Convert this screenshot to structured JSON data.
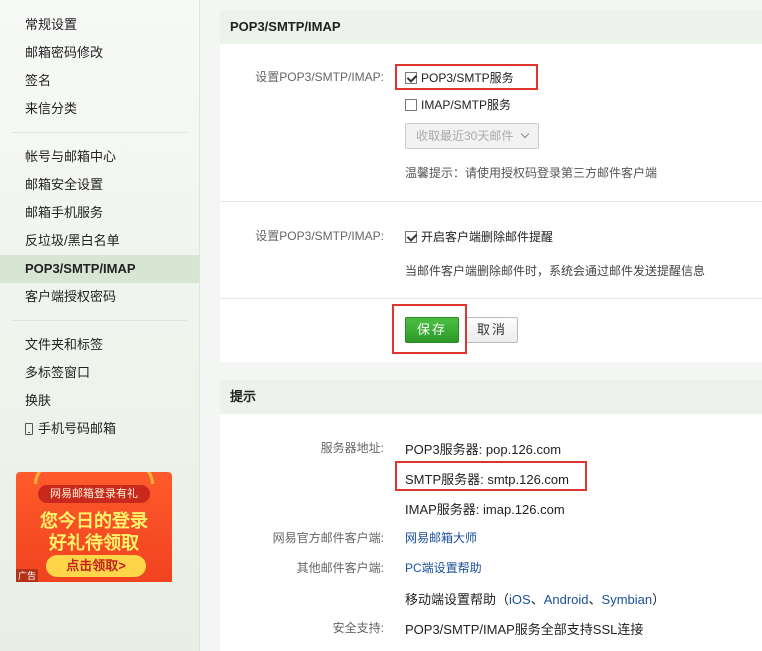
{
  "sidebar": {
    "group1": [
      "常规设置",
      "邮箱密码修改",
      "签名",
      "来信分类"
    ],
    "group2": [
      "帐号与邮箱中心",
      "邮箱安全设置",
      "邮箱手机服务",
      "反垃圾/黑白名单",
      "POP3/SMTP/IMAP",
      "客户端授权密码"
    ],
    "group3": [
      "文件夹和标签",
      "多标签窗口",
      "换肤",
      "手机号码邮箱"
    ],
    "active": "POP3/SMTP/IMAP"
  },
  "promo": {
    "top": "网易邮箱登录有礼",
    "line1": "您今日的登录",
    "line2": "好礼待领取",
    "button": "点击领取>",
    "ad": "广告"
  },
  "pop3_panel": {
    "title": "POP3/SMTP/IMAP",
    "setting_label": "设置POP3/SMTP/IMAP:",
    "pop3_option": "POP3/SMTP服务",
    "imap_option": "IMAP/SMTP服务",
    "fetch_select": "收取最近30天邮件",
    "tip": "温馨提示：请使用授权码登录第三方邮件客户端",
    "setting_label2": "设置POP3/SMTP/IMAP:",
    "delete_remind": "开启客户端删除邮件提醒",
    "delete_desc": "当邮件客户端删除邮件时，系统会通过邮件发送提醒信息",
    "save": "保存",
    "cancel": "取消"
  },
  "tips_panel": {
    "title": "提示",
    "server_label": "服务器地址:",
    "pop3_server": "POP3服务器: pop.126.com",
    "smtp_server": "SMTP服务器: smtp.126.com",
    "imap_server": "IMAP服务器: imap.126.com",
    "official_label": "网易官方邮件客户端:",
    "official_link": "网易邮箱大师",
    "other_label": "其他邮件客户端:",
    "pc_help": "PC端设置帮助",
    "mobile_help_prefix": "移动端设置帮助（",
    "ios": "iOS",
    "sep1": "、",
    "android": "Android",
    "sep2": "、",
    "symbian": "Symbian",
    "mobile_help_suffix": "）",
    "security_label": "安全支持:",
    "security_value": "POP3/SMTP/IMAP服务全部支持SSL连接"
  }
}
